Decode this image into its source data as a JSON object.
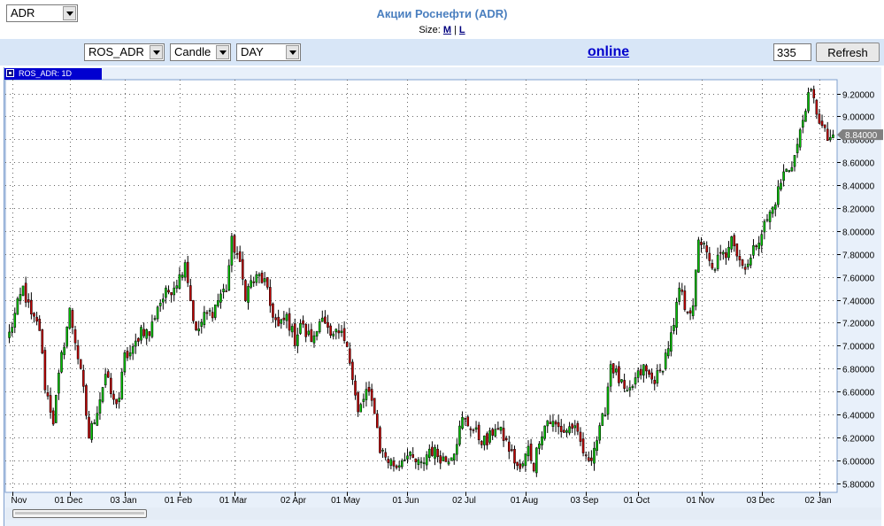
{
  "page": {
    "title": "Акции Роснефти (ADR)",
    "size_label": "Size:",
    "size_m": "M",
    "size_l": "L",
    "size_sep": "|"
  },
  "toolbar": {
    "select_market": "ADR",
    "select_symbol": "ROS_ADR",
    "select_type": "Candle",
    "select_period": "DAY",
    "online_label": "online",
    "bars_value": "335",
    "refresh_label": "Refresh"
  },
  "legend": {
    "label": "ROS_ADR: 1D"
  },
  "colors": {
    "up": "#00c000",
    "down": "#c00000",
    "grid": "#666666",
    "frame_bg": "#e8f0fa",
    "marker_bg": "#808080"
  },
  "chart_data": {
    "type": "candlestick",
    "series_name": "ROS_ADR: 1D",
    "ylim": [
      5.72,
      9.32
    ],
    "y_ticks": [
      "5.80000",
      "6.00000",
      "6.20000",
      "6.40000",
      "6.60000",
      "6.80000",
      "7.00000",
      "7.20000",
      "7.40000",
      "7.60000",
      "7.80000",
      "8.00000",
      "8.20000",
      "8.40000",
      "8.60000",
      "8.80000",
      "9.00000",
      "9.20000"
    ],
    "y_tick_values": [
      5.8,
      6.0,
      6.2,
      6.4,
      6.6,
      6.8,
      7.0,
      7.2,
      7.4,
      7.6,
      7.8,
      8.0,
      8.2,
      8.4,
      8.6,
      8.8,
      9.0,
      9.2
    ],
    "x_ticks": [
      {
        "label": "Nov",
        "bar": 1
      },
      {
        "label": "01 Dec",
        "bar": 22
      },
      {
        "label": "03 Jan",
        "bar": 42
      },
      {
        "label": "01 Feb",
        "bar": 62
      },
      {
        "label": "01 Mar",
        "bar": 82
      },
      {
        "label": "02 Apr",
        "bar": 104
      },
      {
        "label": "01 May",
        "bar": 123
      },
      {
        "label": "01 Jun",
        "bar": 145
      },
      {
        "label": "02 Jul",
        "bar": 166
      },
      {
        "label": "01 Aug",
        "bar": 188
      },
      {
        "label": "03 Sep",
        "bar": 210
      },
      {
        "label": "01 Oct",
        "bar": 229
      },
      {
        "label": "01 Nov",
        "bar": 252
      },
      {
        "label": "03 Dec",
        "bar": 274
      },
      {
        "label": "02 Jan",
        "bar": 295
      }
    ],
    "last_value_label": "8.84000",
    "last_value": 8.84,
    "total_bars": 301,
    "anchors": [
      [
        0,
        7.1
      ],
      [
        3,
        7.35
      ],
      [
        5,
        7.5
      ],
      [
        8,
        7.25
      ],
      [
        11,
        7.15
      ],
      [
        13,
        6.65
      ],
      [
        16,
        6.35
      ],
      [
        19,
        6.9
      ],
      [
        22,
        7.3
      ],
      [
        24,
        7.05
      ],
      [
        27,
        6.6
      ],
      [
        29,
        6.2
      ],
      [
        32,
        6.45
      ],
      [
        35,
        6.75
      ],
      [
        38,
        6.5
      ],
      [
        40,
        6.55
      ],
      [
        42,
        6.9
      ],
      [
        45,
        6.95
      ],
      [
        48,
        7.15
      ],
      [
        51,
        7.1
      ],
      [
        54,
        7.35
      ],
      [
        57,
        7.45
      ],
      [
        59,
        7.5
      ],
      [
        62,
        7.6
      ],
      [
        64,
        7.75
      ],
      [
        66,
        7.4
      ],
      [
        68,
        7.1
      ],
      [
        71,
        7.25
      ],
      [
        74,
        7.3
      ],
      [
        77,
        7.45
      ],
      [
        79,
        7.5
      ],
      [
        81,
        7.9
      ],
      [
        83,
        7.8
      ],
      [
        86,
        7.45
      ],
      [
        88,
        7.55
      ],
      [
        91,
        7.6
      ],
      [
        93,
        7.55
      ],
      [
        95,
        7.35
      ],
      [
        98,
        7.15
      ],
      [
        101,
        7.25
      ],
      [
        104,
        7.05
      ],
      [
        106,
        7.2
      ],
      [
        108,
        7.1
      ],
      [
        111,
        7.05
      ],
      [
        114,
        7.3
      ],
      [
        117,
        7.05
      ],
      [
        120,
        7.1
      ],
      [
        123,
        7.05
      ],
      [
        125,
        6.7
      ],
      [
        127,
        6.4
      ],
      [
        130,
        6.6
      ],
      [
        133,
        6.45
      ],
      [
        135,
        6.1
      ],
      [
        138,
        6.0
      ],
      [
        141,
        5.95
      ],
      [
        144,
        6.05
      ],
      [
        147,
        6.0
      ],
      [
        150,
        5.95
      ],
      [
        153,
        6.1
      ],
      [
        156,
        6.05
      ],
      [
        159,
        6.0
      ],
      [
        162,
        6.1
      ],
      [
        165,
        6.35
      ],
      [
        168,
        6.3
      ],
      [
        171,
        6.2
      ],
      [
        174,
        6.15
      ],
      [
        177,
        6.3
      ],
      [
        180,
        6.2
      ],
      [
        183,
        6.05
      ],
      [
        186,
        5.9
      ],
      [
        189,
        6.1
      ],
      [
        191,
        5.95
      ],
      [
        193,
        6.2
      ],
      [
        196,
        6.35
      ],
      [
        199,
        6.3
      ],
      [
        202,
        6.25
      ],
      [
        205,
        6.3
      ],
      [
        208,
        6.15
      ],
      [
        210,
        6.0
      ],
      [
        212,
        6.05
      ],
      [
        215,
        6.25
      ],
      [
        217,
        6.45
      ],
      [
        219,
        6.85
      ],
      [
        222,
        6.7
      ],
      [
        225,
        6.55
      ],
      [
        228,
        6.7
      ],
      [
        231,
        6.8
      ],
      [
        234,
        6.7
      ],
      [
        237,
        6.75
      ],
      [
        240,
        7.0
      ],
      [
        242,
        7.15
      ],
      [
        244,
        7.5
      ],
      [
        246,
        7.35
      ],
      [
        249,
        7.3
      ],
      [
        251,
        7.95
      ],
      [
        253,
        7.85
      ],
      [
        256,
        7.65
      ],
      [
        258,
        7.75
      ],
      [
        261,
        7.8
      ],
      [
        263,
        8.0
      ],
      [
        265,
        7.8
      ],
      [
        267,
        7.7
      ],
      [
        270,
        7.75
      ],
      [
        272,
        7.9
      ],
      [
        274,
        8.0
      ],
      [
        276,
        8.1
      ],
      [
        278,
        8.2
      ],
      [
        280,
        8.35
      ],
      [
        282,
        8.5
      ],
      [
        284,
        8.55
      ],
      [
        286,
        8.65
      ],
      [
        288,
        8.85
      ],
      [
        290,
        9.1
      ],
      [
        292,
        9.2
      ],
      [
        294,
        9.05
      ],
      [
        296,
        8.9
      ],
      [
        298,
        8.8
      ],
      [
        300,
        8.84
      ]
    ]
  }
}
